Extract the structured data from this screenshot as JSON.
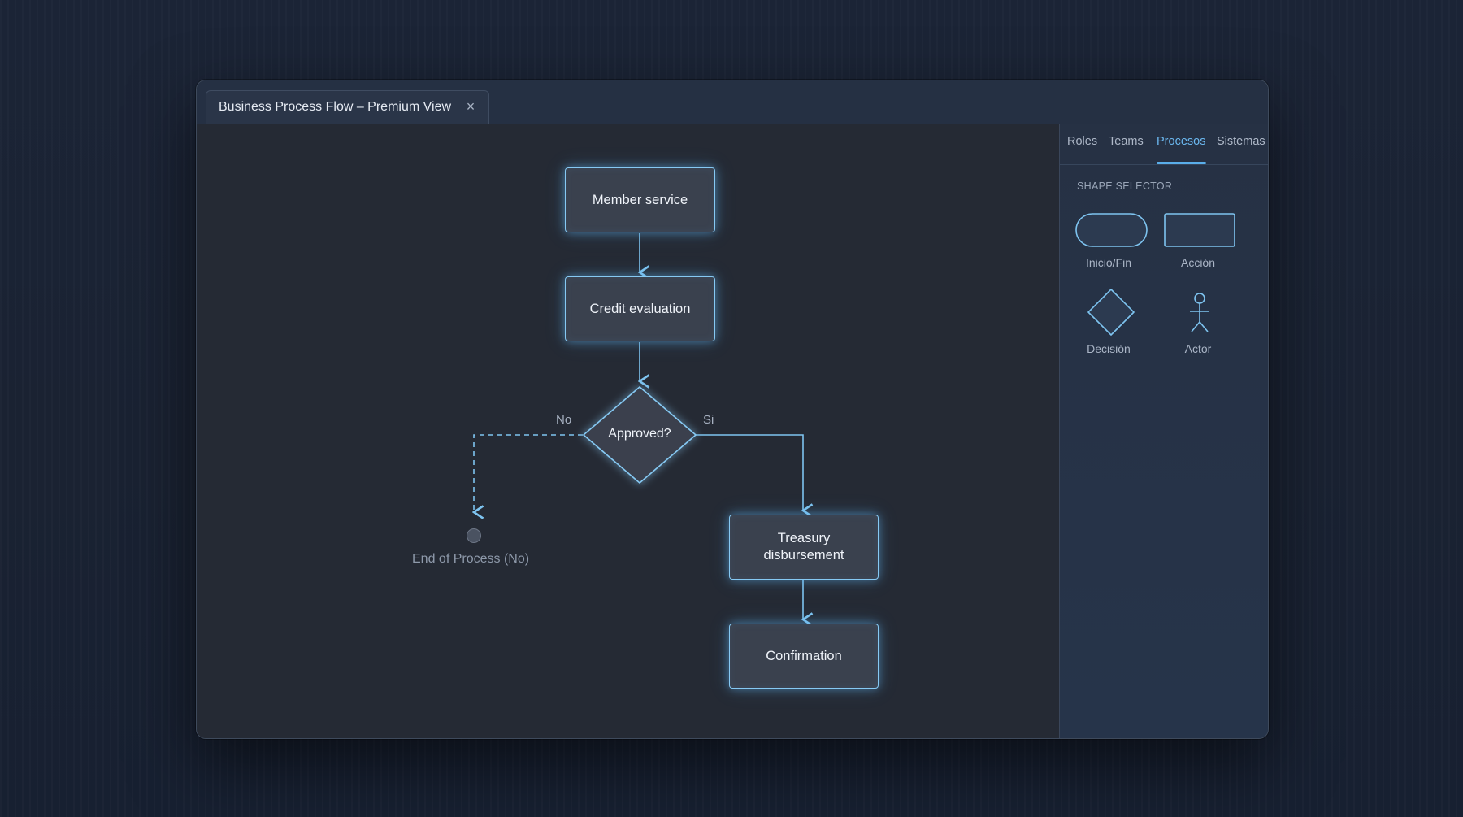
{
  "window": {
    "tab_title": "Business Process Flow – Premium View",
    "close_glyph": "×"
  },
  "sidebar": {
    "tabs": [
      {
        "label": "Roles",
        "active": false
      },
      {
        "label": "Teams",
        "active": false
      },
      {
        "label": "Procesos",
        "active": true
      },
      {
        "label": "Sistemas",
        "active": false
      }
    ],
    "section_title": "SHAPE SELECTOR",
    "shapes": [
      {
        "label": "Inicio/Fin",
        "icon": "pill-shape-icon"
      },
      {
        "label": "Acción",
        "icon": "rectangle-shape-icon"
      },
      {
        "label": "Decisión",
        "icon": "diamond-shape-icon"
      },
      {
        "label": "Actor",
        "icon": "actor-stick-figure-icon"
      }
    ]
  },
  "flow": {
    "nodes": {
      "member_service": "Member service",
      "credit_evaluation": "Credit evaluation",
      "approved": "Approved?",
      "treasury_line1": "Treasury",
      "treasury_line2": "disbursement",
      "confirmation": "Confirmation",
      "end_no": "End of Process (No)"
    },
    "edge_labels": {
      "no": "No",
      "yes": "Si"
    }
  },
  "colors": {
    "accent": "#5aaeea",
    "node_border": "#86c9f3",
    "node_fill": "#3a414e",
    "canvas": "#252a34",
    "sidebar": "#263144"
  }
}
